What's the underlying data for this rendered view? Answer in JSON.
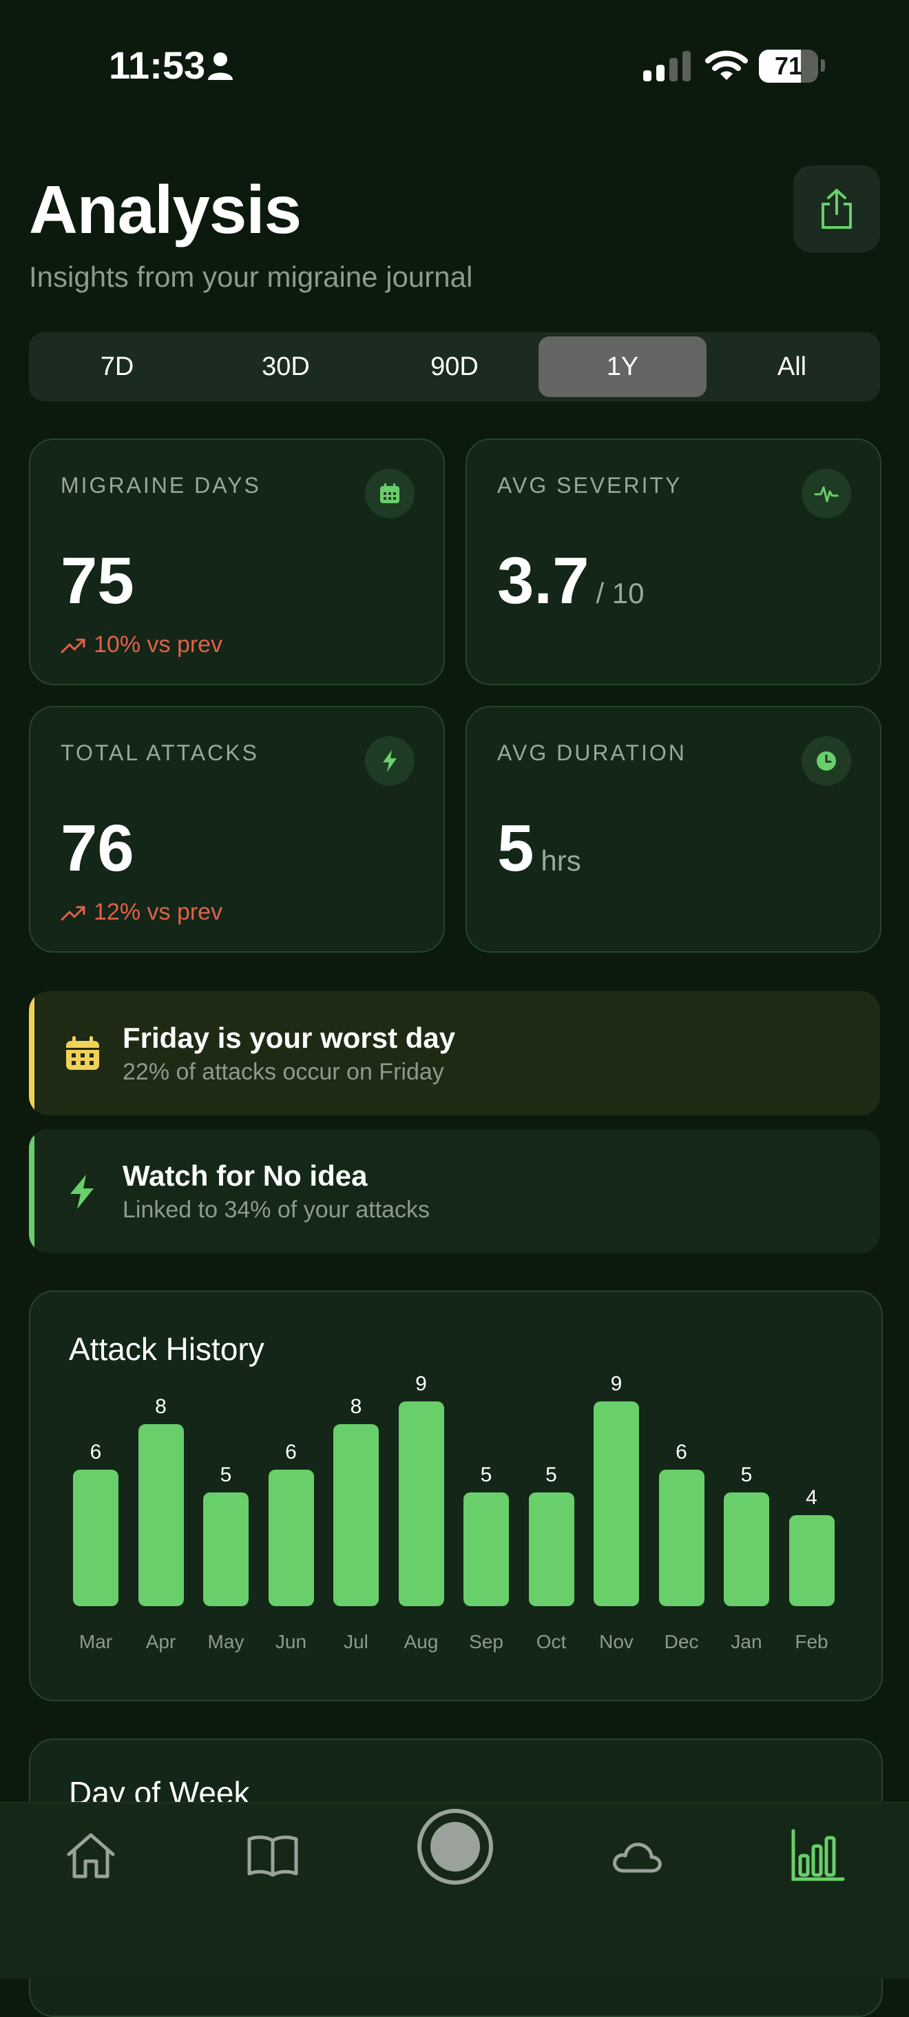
{
  "status_bar": {
    "time": "11:53",
    "battery": "71",
    "battery_level": 71
  },
  "header": {
    "title": "Analysis",
    "subtitle": "Insights from your migraine journal"
  },
  "range_tabs": {
    "items": [
      "7D",
      "30D",
      "90D",
      "1Y",
      "All"
    ],
    "selected": "1Y"
  },
  "stats": {
    "migraine_days": {
      "label": "MIGRAINE DAYS",
      "value": "75",
      "change": "10% vs prev"
    },
    "avg_severity": {
      "label": "AVG SEVERITY",
      "value": "3.7",
      "unit": "/ 10"
    },
    "total_attacks": {
      "label": "TOTAL ATTACKS",
      "value": "76",
      "change": "12% vs prev"
    },
    "avg_duration": {
      "label": "AVG DURATION",
      "value": "5",
      "unit": "hrs"
    }
  },
  "insights": [
    {
      "title": "Friday is your worst day",
      "subtitle": "22% of attacks occur on Friday",
      "icon": "calendar-icon",
      "accent": "#f2d15a"
    },
    {
      "title": "Watch for No idea",
      "subtitle": "Linked to 34% of your attacks",
      "icon": "bolt-icon",
      "accent": "#69cf6a"
    }
  ],
  "attack_history": {
    "title": "Attack History"
  },
  "chart_data": {
    "type": "bar",
    "title": "Attack History",
    "categories": [
      "Mar",
      "Apr",
      "May",
      "Jun",
      "Jul",
      "Aug",
      "Sep",
      "Oct",
      "Nov",
      "Dec",
      "Jan",
      "Feb"
    ],
    "values": [
      6,
      8,
      5,
      6,
      8,
      9,
      5,
      5,
      9,
      6,
      5,
      4
    ],
    "color": "#69cf6a",
    "grid": false
  },
  "day_of_week": {
    "title": "Day of Week"
  },
  "tabbar": {
    "items": [
      "home-icon",
      "journal-icon",
      "record-button",
      "weather-icon",
      "analysis-icon"
    ],
    "active": "analysis-icon",
    "active_color": "#69cf6a",
    "inactive_color": "#9aa29b"
  }
}
